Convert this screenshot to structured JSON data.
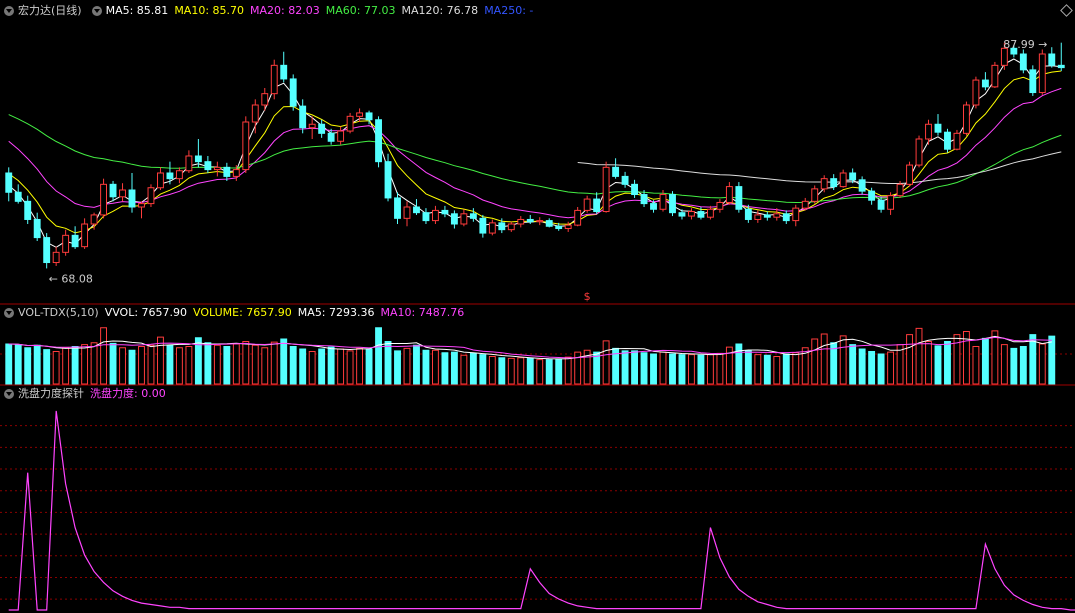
{
  "main_header": {
    "title": "宏力达(日线)",
    "ma": [
      {
        "label": "MA5: 85.81",
        "color": "#ffffff"
      },
      {
        "label": "MA10: 85.70",
        "color": "#ffff00"
      },
      {
        "label": "MA20: 82.03",
        "color": "#ff44ff"
      },
      {
        "label": "MA60: 77.03",
        "color": "#44ee44"
      },
      {
        "label": "MA120: 76.78",
        "color": "#dddddd"
      },
      {
        "label": "MA250: -",
        "color": "#3355ff"
      }
    ]
  },
  "vol_header": {
    "title": "VOL-TDX(5,10)",
    "items": [
      {
        "label": "VVOL: 7657.90",
        "color": "#ffffff"
      },
      {
        "label": "VOLUME: 7657.90",
        "color": "#ffff00"
      },
      {
        "label": "MA5: 7293.36",
        "color": "#ffffff"
      },
      {
        "label": "MA10: 7487.76",
        "color": "#ff44ff"
      }
    ]
  },
  "ind_header": {
    "title": "洗盘力度探针",
    "items": [
      {
        "label": "洗盘力度: 0.00",
        "color": "#ff44ff"
      }
    ]
  },
  "annotations": {
    "high_label": "87.99",
    "low_label": "68.08",
    "marker": "$"
  },
  "colors": {
    "up": "#ff3c3c",
    "down": "#54ffff",
    "grid": "#8b0000",
    "indicator": "#ff44ff"
  },
  "chart_data": [
    {
      "type": "candlestick",
      "title": "宏力达(日线)",
      "ylim": [
        66,
        90
      ],
      "high": 87.99,
      "low": 68.08,
      "ohlc": [
        [
          76.5,
          77.0,
          74.0,
          74.8
        ],
        [
          74.8,
          75.5,
          73.8,
          74.0
        ],
        [
          74.0,
          74.5,
          72.0,
          72.4
        ],
        [
          72.4,
          73.0,
          70.5,
          70.8
        ],
        [
          70.8,
          71.2,
          68.08,
          68.6
        ],
        [
          68.6,
          70.0,
          68.3,
          69.5
        ],
        [
          69.5,
          71.5,
          69.2,
          71.0
        ],
        [
          71.0,
          71.8,
          69.8,
          70.0
        ],
        [
          70.0,
          72.5,
          69.8,
          72.0
        ],
        [
          72.0,
          73.0,
          71.5,
          72.8
        ],
        [
          72.8,
          76.0,
          72.5,
          75.5
        ],
        [
          75.5,
          75.8,
          74.0,
          74.4
        ],
        [
          74.4,
          75.6,
          74.0,
          75.0
        ],
        [
          75.0,
          76.5,
          73.0,
          73.5
        ],
        [
          73.5,
          74.0,
          72.5,
          73.8
        ],
        [
          73.8,
          75.5,
          73.5,
          75.2
        ],
        [
          75.2,
          77.0,
          75.0,
          76.5
        ],
        [
          76.5,
          77.5,
          75.5,
          76.0
        ],
        [
          76.0,
          77.0,
          75.6,
          76.7
        ],
        [
          76.7,
          78.5,
          76.5,
          78.0
        ],
        [
          78.0,
          79.5,
          77.0,
          77.5
        ],
        [
          77.5,
          78.0,
          76.5,
          76.8
        ],
        [
          76.8,
          77.5,
          76.2,
          77.0
        ],
        [
          77.0,
          77.4,
          75.8,
          76.2
        ],
        [
          76.2,
          77.2,
          75.8,
          76.8
        ],
        [
          76.8,
          81.5,
          76.5,
          81.0
        ],
        [
          81.0,
          83.0,
          80.0,
          82.5
        ],
        [
          82.5,
          84.0,
          82.0,
          83.5
        ],
        [
          83.5,
          86.5,
          83.0,
          86.0
        ],
        [
          86.0,
          87.2,
          84.5,
          84.8
        ],
        [
          84.8,
          85.2,
          82.0,
          82.4
        ],
        [
          82.4,
          83.0,
          80.0,
          80.5
        ],
        [
          80.5,
          81.5,
          79.5,
          80.8
        ],
        [
          80.8,
          81.2,
          79.6,
          80.0
        ],
        [
          80.0,
          80.4,
          79.0,
          79.3
        ],
        [
          79.3,
          80.6,
          79.0,
          80.2
        ],
        [
          80.2,
          81.8,
          80.0,
          81.5
        ],
        [
          81.5,
          82.2,
          81.0,
          81.8
        ],
        [
          81.8,
          82.0,
          80.8,
          81.2
        ],
        [
          81.2,
          81.5,
          77.0,
          77.5
        ],
        [
          77.5,
          78.2,
          74.0,
          74.3
        ],
        [
          74.3,
          74.8,
          72.0,
          72.5
        ],
        [
          72.5,
          74.0,
          71.8,
          73.5
        ],
        [
          73.5,
          74.2,
          72.8,
          73.0
        ],
        [
          73.0,
          73.4,
          72.0,
          72.3
        ],
        [
          72.3,
          73.6,
          72.0,
          73.2
        ],
        [
          73.2,
          73.6,
          72.6,
          72.9
        ],
        [
          72.9,
          73.2,
          71.6,
          72.0
        ],
        [
          72.0,
          73.3,
          71.8,
          72.9
        ],
        [
          72.9,
          73.4,
          72.2,
          72.5
        ],
        [
          72.5,
          72.8,
          70.8,
          71.2
        ],
        [
          71.2,
          72.4,
          71.0,
          72.1
        ],
        [
          72.1,
          72.5,
          71.2,
          71.5
        ],
        [
          71.5,
          72.2,
          71.3,
          72.0
        ],
        [
          72.0,
          72.7,
          71.7,
          72.4
        ],
        [
          72.4,
          72.8,
          72.0,
          72.2
        ],
        [
          72.2,
          72.6,
          71.9,
          72.3
        ],
        [
          72.3,
          72.5,
          71.7,
          71.8
        ],
        [
          71.8,
          72.1,
          71.4,
          71.6
        ],
        [
          71.6,
          72.2,
          71.3,
          71.9
        ],
        [
          71.9,
          73.5,
          71.8,
          73.2
        ],
        [
          73.2,
          74.5,
          73.0,
          74.2
        ],
        [
          74.2,
          74.8,
          72.9,
          73.1
        ],
        [
          73.1,
          77.5,
          73.0,
          77.0
        ],
        [
          77.0,
          77.8,
          76.0,
          76.2
        ],
        [
          76.2,
          76.6,
          75.2,
          75.5
        ],
        [
          75.5,
          75.9,
          74.3,
          74.6
        ],
        [
          74.6,
          75.0,
          73.5,
          73.8
        ],
        [
          73.8,
          74.1,
          73.0,
          73.3
        ],
        [
          73.3,
          75.0,
          73.1,
          74.6
        ],
        [
          74.6,
          74.9,
          72.7,
          73.0
        ],
        [
          73.0,
          73.3,
          72.4,
          72.7
        ],
        [
          72.7,
          73.4,
          72.4,
          73.1
        ],
        [
          73.1,
          73.5,
          72.4,
          72.6
        ],
        [
          72.6,
          73.6,
          72.4,
          73.3
        ],
        [
          73.3,
          74.2,
          73.0,
          73.9
        ],
        [
          73.9,
          75.7,
          73.7,
          75.3
        ],
        [
          75.3,
          75.7,
          73.0,
          73.3
        ],
        [
          73.3,
          73.7,
          72.1,
          72.4
        ],
        [
          72.4,
          73.2,
          72.1,
          72.8
        ],
        [
          72.8,
          73.1,
          72.3,
          72.6
        ],
        [
          72.6,
          73.4,
          72.3,
          72.9
        ],
        [
          72.9,
          73.2,
          72.0,
          72.3
        ],
        [
          72.3,
          73.7,
          71.8,
          73.4
        ],
        [
          73.4,
          74.3,
          73.2,
          74.0
        ],
        [
          74.0,
          75.4,
          73.8,
          75.1
        ],
        [
          75.1,
          76.3,
          74.8,
          76.0
        ],
        [
          76.0,
          76.4,
          75.0,
          75.3
        ],
        [
          75.3,
          76.8,
          75.2,
          76.5
        ],
        [
          76.5,
          76.9,
          75.6,
          75.9
        ],
        [
          75.9,
          76.2,
          74.6,
          74.9
        ],
        [
          74.9,
          75.2,
          73.7,
          74.1
        ],
        [
          74.1,
          74.4,
          73.0,
          73.3
        ],
        [
          73.3,
          74.8,
          72.8,
          74.5
        ],
        [
          74.5,
          75.8,
          74.3,
          75.5
        ],
        [
          75.5,
          77.5,
          75.3,
          77.2
        ],
        [
          77.2,
          79.8,
          77.0,
          79.5
        ],
        [
          79.5,
          81.2,
          79.0,
          80.8
        ],
        [
          80.8,
          81.7,
          79.8,
          80.1
        ],
        [
          80.1,
          80.4,
          78.3,
          78.6
        ],
        [
          78.6,
          80.3,
          78.5,
          80.0
        ],
        [
          80.0,
          82.8,
          79.8,
          82.5
        ],
        [
          82.5,
          85.0,
          82.2,
          84.7
        ],
        [
          84.7,
          85.4,
          83.8,
          84.1
        ],
        [
          84.1,
          86.3,
          84.0,
          86.0
        ],
        [
          86.0,
          87.99,
          85.6,
          87.5
        ],
        [
          87.5,
          87.8,
          86.7,
          87.0
        ],
        [
          87.0,
          87.4,
          85.3,
          85.6
        ],
        [
          85.6,
          86.0,
          83.3,
          83.6
        ],
        [
          83.6,
          87.4,
          83.4,
          87.0
        ],
        [
          87.0,
          87.6,
          85.8,
          86.0
        ],
        [
          86.0,
          88.0,
          85.5,
          85.8
        ]
      ]
    },
    {
      "type": "bar",
      "title": "VOL-TDX(5,10)",
      "series": [
        {
          "name": "VVOL",
          "values": [
            6400,
            6300,
            5800,
            6200,
            5500,
            5200,
            5800,
            6000,
            6300,
            6600,
            9000,
            6500,
            5800,
            5400,
            6000,
            6200,
            7500,
            6200,
            5800,
            6000,
            7400,
            6600,
            6200,
            6000,
            6400,
            6800,
            6200,
            5800,
            6700,
            7200,
            6000,
            5600,
            5200,
            5600,
            5900,
            5600,
            5300,
            5700,
            5600,
            9000,
            6800,
            5300,
            5700,
            6200,
            5400,
            5400,
            5000,
            5100,
            4600,
            4900,
            4700,
            4400,
            4200,
            4100,
            4200,
            4100,
            3900,
            3900,
            4000,
            4300,
            5100,
            5400,
            5100,
            6900,
            5700,
            5300,
            5300,
            5000,
            4800,
            5100,
            4800,
            4700,
            4700,
            4600,
            4700,
            4900,
            5900,
            6400,
            5300,
            4700,
            4600,
            4400,
            4800,
            5000,
            5800,
            7200,
            8000,
            6600,
            7700,
            6300,
            5600,
            5200,
            4800,
            5100,
            6300,
            7900,
            8900,
            6800,
            6100,
            6800,
            7900,
            8400,
            6000,
            7300,
            8500,
            6300,
            5700,
            6000,
            7900,
            6400,
            7658
          ]
        }
      ]
    },
    {
      "type": "line",
      "title": "洗盘力度探针",
      "series": [
        {
          "name": "洗盘力度",
          "values": [
            0,
            0,
            100,
            0,
            0,
            145,
            92,
            60,
            40,
            28,
            20,
            14,
            10,
            7,
            5,
            4,
            3,
            2,
            2,
            1,
            1,
            1,
            1,
            1,
            1,
            1,
            1,
            1,
            1,
            1,
            1,
            1,
            1,
            1,
            1,
            1,
            1,
            1,
            1,
            1,
            1,
            1,
            1,
            1,
            1,
            1,
            1,
            1,
            1,
            1,
            1,
            1,
            1,
            1,
            1,
            30,
            20,
            12,
            8,
            5,
            3,
            2,
            1,
            1,
            1,
            1,
            1,
            1,
            1,
            1,
            1,
            1,
            1,
            1,
            60,
            38,
            24,
            15,
            10,
            6,
            4,
            2,
            1,
            1,
            1,
            1,
            1,
            1,
            1,
            1,
            1,
            1,
            1,
            1,
            1,
            1,
            1,
            1,
            1,
            1,
            1,
            1,
            1,
            48,
            30,
            18,
            11,
            7,
            4,
            2,
            1,
            1,
            0,
            0,
            0
          ]
        }
      ]
    }
  ]
}
